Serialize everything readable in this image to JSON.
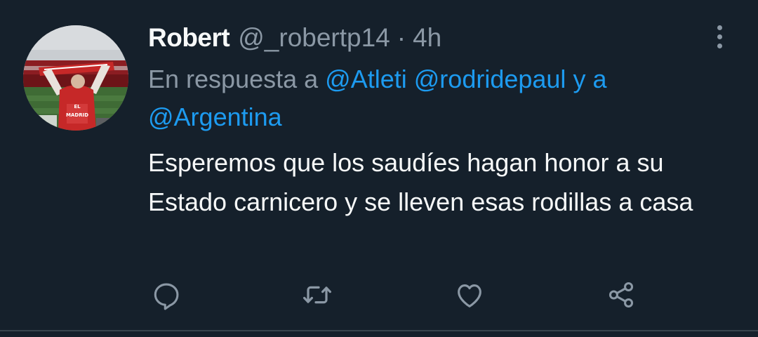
{
  "tweet": {
    "author_name": "Robert",
    "handle": "@_robertp14",
    "separator": "·",
    "time": "4h",
    "reply_prefix": "En respuesta a",
    "mentions": [
      "@Atleti",
      "@rodridepaul",
      "y a",
      "@Argentina"
    ],
    "text": "Esperemos que los saudíes hagan honor a su Estado carnicero y se lleven esas rodillas a casa"
  },
  "icons": {
    "more": "more-vertical-icon",
    "reply": "reply-icon",
    "retweet": "retweet-icon",
    "like": "like-icon",
    "share": "share-icon"
  },
  "colors": {
    "background": "#15202b",
    "text_primary": "#f7f9f9",
    "text_secondary": "#8b98a5",
    "link": "#1d9bf0",
    "divider": "#38444d"
  }
}
